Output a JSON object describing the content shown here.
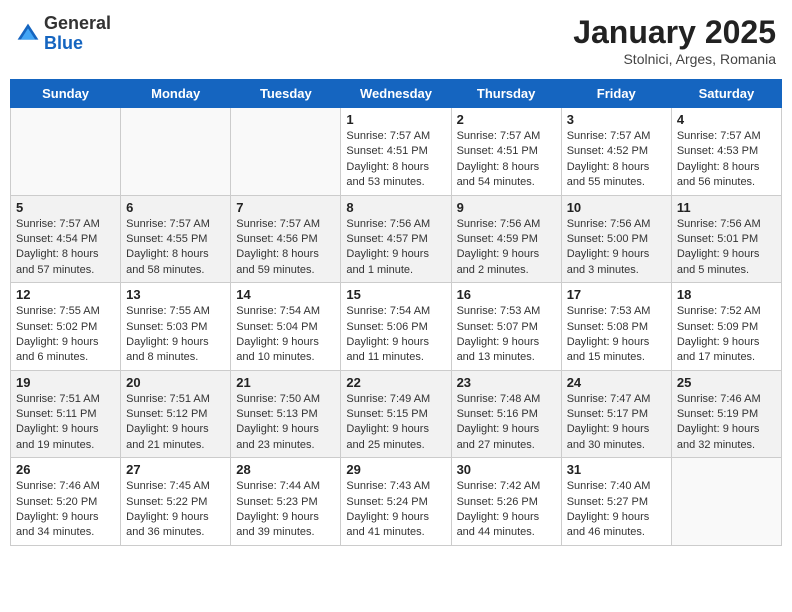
{
  "header": {
    "logo_general": "General",
    "logo_blue": "Blue",
    "title": "January 2025",
    "subtitle": "Stolnici, Arges, Romania"
  },
  "weekdays": [
    "Sunday",
    "Monday",
    "Tuesday",
    "Wednesday",
    "Thursday",
    "Friday",
    "Saturday"
  ],
  "weeks": [
    [
      {
        "day": "",
        "empty": true
      },
      {
        "day": "",
        "empty": true
      },
      {
        "day": "",
        "empty": true
      },
      {
        "day": "1",
        "sunrise": "7:57 AM",
        "sunset": "4:51 PM",
        "daylight": "8 hours and 53 minutes."
      },
      {
        "day": "2",
        "sunrise": "7:57 AM",
        "sunset": "4:51 PM",
        "daylight": "8 hours and 54 minutes."
      },
      {
        "day": "3",
        "sunrise": "7:57 AM",
        "sunset": "4:52 PM",
        "daylight": "8 hours and 55 minutes."
      },
      {
        "day": "4",
        "sunrise": "7:57 AM",
        "sunset": "4:53 PM",
        "daylight": "8 hours and 56 minutes."
      }
    ],
    [
      {
        "day": "5",
        "sunrise": "7:57 AM",
        "sunset": "4:54 PM",
        "daylight": "8 hours and 57 minutes."
      },
      {
        "day": "6",
        "sunrise": "7:57 AM",
        "sunset": "4:55 PM",
        "daylight": "8 hours and 58 minutes."
      },
      {
        "day": "7",
        "sunrise": "7:57 AM",
        "sunset": "4:56 PM",
        "daylight": "8 hours and 59 minutes."
      },
      {
        "day": "8",
        "sunrise": "7:56 AM",
        "sunset": "4:57 PM",
        "daylight": "9 hours and 1 minute."
      },
      {
        "day": "9",
        "sunrise": "7:56 AM",
        "sunset": "4:59 PM",
        "daylight": "9 hours and 2 minutes."
      },
      {
        "day": "10",
        "sunrise": "7:56 AM",
        "sunset": "5:00 PM",
        "daylight": "9 hours and 3 minutes."
      },
      {
        "day": "11",
        "sunrise": "7:56 AM",
        "sunset": "5:01 PM",
        "daylight": "9 hours and 5 minutes."
      }
    ],
    [
      {
        "day": "12",
        "sunrise": "7:55 AM",
        "sunset": "5:02 PM",
        "daylight": "9 hours and 6 minutes."
      },
      {
        "day": "13",
        "sunrise": "7:55 AM",
        "sunset": "5:03 PM",
        "daylight": "9 hours and 8 minutes."
      },
      {
        "day": "14",
        "sunrise": "7:54 AM",
        "sunset": "5:04 PM",
        "daylight": "9 hours and 10 minutes."
      },
      {
        "day": "15",
        "sunrise": "7:54 AM",
        "sunset": "5:06 PM",
        "daylight": "9 hours and 11 minutes."
      },
      {
        "day": "16",
        "sunrise": "7:53 AM",
        "sunset": "5:07 PM",
        "daylight": "9 hours and 13 minutes."
      },
      {
        "day": "17",
        "sunrise": "7:53 AM",
        "sunset": "5:08 PM",
        "daylight": "9 hours and 15 minutes."
      },
      {
        "day": "18",
        "sunrise": "7:52 AM",
        "sunset": "5:09 PM",
        "daylight": "9 hours and 17 minutes."
      }
    ],
    [
      {
        "day": "19",
        "sunrise": "7:51 AM",
        "sunset": "5:11 PM",
        "daylight": "9 hours and 19 minutes."
      },
      {
        "day": "20",
        "sunrise": "7:51 AM",
        "sunset": "5:12 PM",
        "daylight": "9 hours and 21 minutes."
      },
      {
        "day": "21",
        "sunrise": "7:50 AM",
        "sunset": "5:13 PM",
        "daylight": "9 hours and 23 minutes."
      },
      {
        "day": "22",
        "sunrise": "7:49 AM",
        "sunset": "5:15 PM",
        "daylight": "9 hours and 25 minutes."
      },
      {
        "day": "23",
        "sunrise": "7:48 AM",
        "sunset": "5:16 PM",
        "daylight": "9 hours and 27 minutes."
      },
      {
        "day": "24",
        "sunrise": "7:47 AM",
        "sunset": "5:17 PM",
        "daylight": "9 hours and 30 minutes."
      },
      {
        "day": "25",
        "sunrise": "7:46 AM",
        "sunset": "5:19 PM",
        "daylight": "9 hours and 32 minutes."
      }
    ],
    [
      {
        "day": "26",
        "sunrise": "7:46 AM",
        "sunset": "5:20 PM",
        "daylight": "9 hours and 34 minutes."
      },
      {
        "day": "27",
        "sunrise": "7:45 AM",
        "sunset": "5:22 PM",
        "daylight": "9 hours and 36 minutes."
      },
      {
        "day": "28",
        "sunrise": "7:44 AM",
        "sunset": "5:23 PM",
        "daylight": "9 hours and 39 minutes."
      },
      {
        "day": "29",
        "sunrise": "7:43 AM",
        "sunset": "5:24 PM",
        "daylight": "9 hours and 41 minutes."
      },
      {
        "day": "30",
        "sunrise": "7:42 AM",
        "sunset": "5:26 PM",
        "daylight": "9 hours and 44 minutes."
      },
      {
        "day": "31",
        "sunrise": "7:40 AM",
        "sunset": "5:27 PM",
        "daylight": "9 hours and 46 minutes."
      },
      {
        "day": "",
        "empty": true
      }
    ]
  ]
}
